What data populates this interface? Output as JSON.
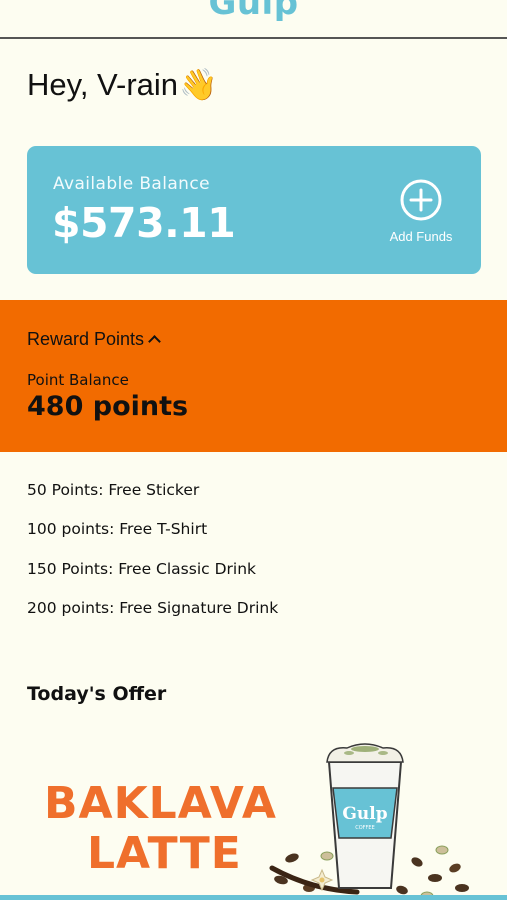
{
  "header": {
    "brand": "Gulp"
  },
  "greeting": {
    "text": "Hey, V-rain",
    "emoji": "👋"
  },
  "balance": {
    "label": "Available Balance",
    "amount": "$573.11",
    "add_funds_label": "Add Funds"
  },
  "rewards": {
    "toggle_label": "Reward Points",
    "point_label": "Point Balance",
    "point_value": "480 points",
    "items": [
      "50 Points: Free Sticker",
      "100 points: Free T-Shirt",
      "150 Points: Free Classic Drink",
      "200 points: Free Signature Drink"
    ]
  },
  "offer": {
    "title": "Today's Offer",
    "line1": "BAKLAVA",
    "line2": "LATTE",
    "cup_brand": "Gulp",
    "cup_sub": "COFFEE"
  },
  "colors": {
    "accent_blue": "#67c2d5",
    "accent_orange": "#f26b00",
    "offer_text": "#ef6f2c",
    "background": "#fdfdf1"
  },
  "icons": {
    "add_funds": "plus-circle-icon",
    "rewards_toggle": "chevron-up-icon"
  }
}
